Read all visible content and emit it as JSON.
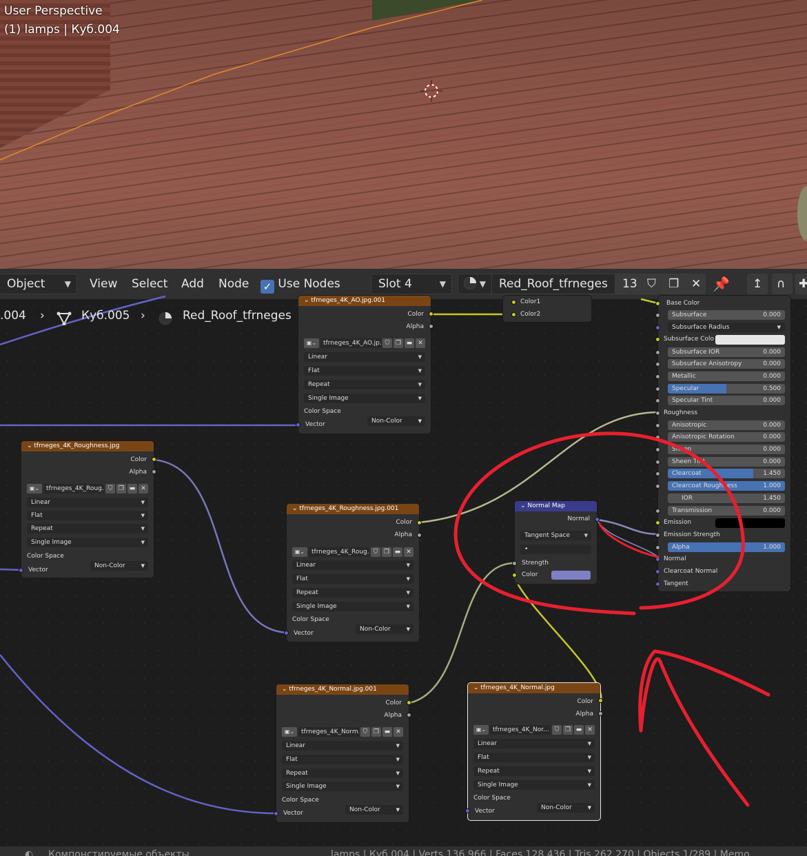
{
  "viewport": {
    "mode": "User Perspective",
    "object_info": "(1) lamps | Куб.004"
  },
  "header": {
    "mode": "Object",
    "view": "View",
    "select": "Select",
    "add": "Add",
    "node": "Node",
    "use_nodes": "Use Nodes",
    "slot": "Slot 4",
    "material": "Red_Roof_tfrneges",
    "users": "13"
  },
  "breadcrumb": {
    "prev": ".004",
    "mesh": "Куб.005",
    "material": "Red_Roof_tfrneges"
  },
  "common": {
    "linear": "Linear",
    "flat": "Flat",
    "repeat": "Repeat",
    "single": "Single Image",
    "colorspace": "Color Space",
    "noncolor": "Non-Color",
    "color": "Color",
    "alpha": "Alpha",
    "vector": "Vector"
  },
  "nodes": {
    "ao": {
      "title": "tfrneges_4K_AO.jpg.001",
      "image": "tfrneges_4K_AO.jp..."
    },
    "rough1": {
      "title": "tfrneges_4K_Roughness.jpg",
      "image": "tfrneges_4K_Roug..."
    },
    "rough2": {
      "title": "tfrneges_4K_Roughness.jpg.001",
      "image": "tfrneges_4K_Roug..."
    },
    "normal1": {
      "title": "tfrneges_4K_Normal.jpg.001",
      "image": "tfrneges_4K_Norm..."
    },
    "normal2": {
      "title": "tfrneges_4K_Normal.jpg",
      "image": "tfrneges_4K_Nor..."
    },
    "mix": {
      "color1": "Color1",
      "color2": "Color2"
    },
    "normalmap": {
      "title": "Normal Map",
      "out": "Normal",
      "space": "Tangent Space",
      "uv": "•",
      "strength": "Strength",
      "color": "Color"
    }
  },
  "bsdf": {
    "base_color": "Base Color",
    "subsurface": {
      "label": "Subsurface",
      "value": "0.000"
    },
    "subsurface_radius": "Subsurface Radius",
    "subsurface_color": "Subsurface Colo",
    "subsurface_ior": {
      "label": "Subsurface IOR",
      "value": "0.000"
    },
    "subsurface_aniso": {
      "label": "Subsurface Anisotropy",
      "value": "0.000"
    },
    "metallic": {
      "label": "Metallic",
      "value": "0.000"
    },
    "specular": {
      "label": "Specular",
      "value": "0.500",
      "fraction": 0.5
    },
    "specular_tint": {
      "label": "Specular Tint",
      "value": "0.000"
    },
    "roughness": "Roughness",
    "anisotropic": {
      "label": "Anisotropic",
      "value": "0.000"
    },
    "aniso_rotation": {
      "label": "Anisotropic Rotation",
      "value": "0.000"
    },
    "sheen": {
      "label": "Sheen",
      "value": "0.000"
    },
    "sheen_tint": {
      "label": "Sheen Tint",
      "value": "0.000"
    },
    "clearcoat": {
      "label": "Clearcoat",
      "value": "1.450",
      "fraction": 0.73
    },
    "clearcoat_rough": {
      "label": "Clearcoat Roughness",
      "value": "1.000",
      "fraction": 1.0
    },
    "ior": {
      "label": "IOR",
      "value": "1.450"
    },
    "transmission": {
      "label": "Transmission",
      "value": "0.000"
    },
    "emission": "Emission",
    "emission_strength": "Emission Strength",
    "alpha": {
      "label": "Alpha",
      "value": "1.000",
      "fraction": 1.0
    },
    "normal": "Normal",
    "clearcoat_normal": "Clearcoat Normal",
    "tangent": "Tangent"
  },
  "status": {
    "left": "Компонстируемые объекты",
    "right": "lamps | Куб.004 | Verts 136,966 | Faces 128,436 | Tris 262,270 | Objects 1/289 | Memo"
  },
  "colors": {
    "texture_header": "#7a4514",
    "vector_header": "#3b3b8c",
    "annotation": "#e8202f",
    "slider_blue": "#4772b3"
  }
}
